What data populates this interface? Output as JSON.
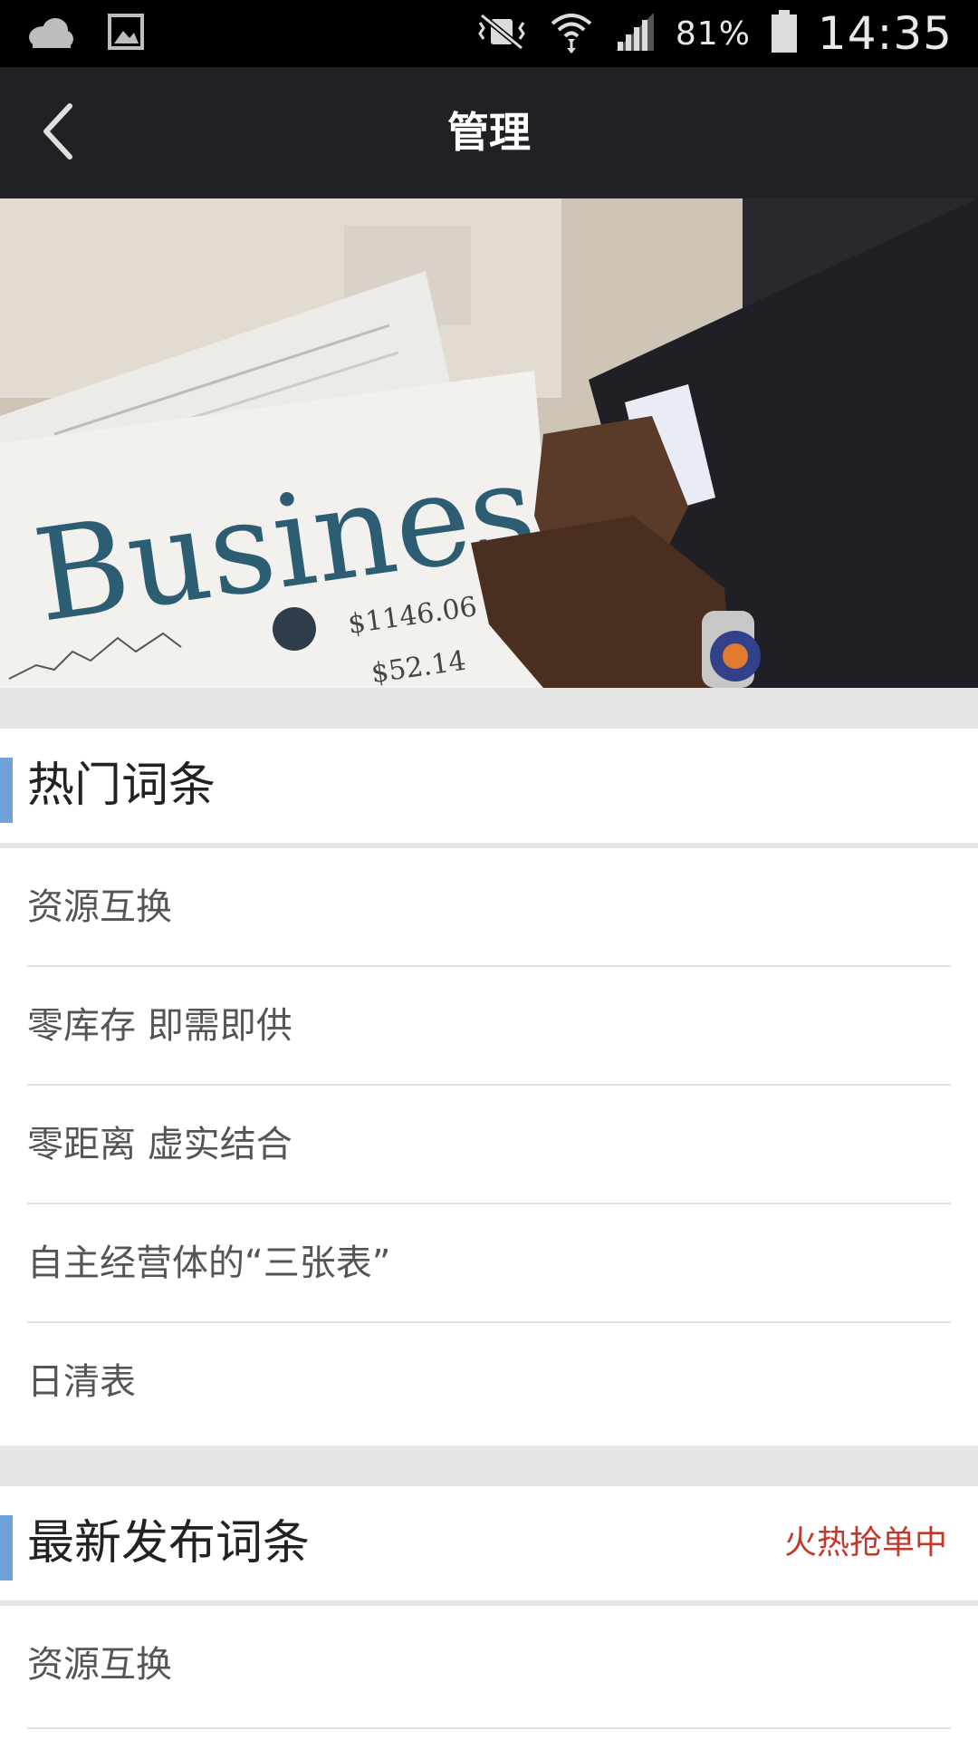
{
  "status_bar": {
    "battery_percent": "81%",
    "time": "14:35",
    "icons": [
      "cloud-icon",
      "image-icon",
      "vibrate-mute-icon",
      "wifi-icon",
      "signal-icon",
      "battery-icon"
    ]
  },
  "app_bar": {
    "title": "管理",
    "back_icon": "chevron-left-icon"
  },
  "banner": {
    "headline": "Business",
    "price_1": "$1146.06",
    "price_2": "$52.14"
  },
  "hot_section": {
    "title": "热门词条",
    "items": [
      {
        "label": "资源互换"
      },
      {
        "label": "零库存 即需即供"
      },
      {
        "label": "零距离 虚实结合"
      },
      {
        "label": "自主经营体的“三张表”"
      },
      {
        "label": "日清表"
      }
    ]
  },
  "latest_section": {
    "title": "最新发布词条",
    "extra": "火热抢单中",
    "items": [
      {
        "label": "资源互换"
      }
    ]
  },
  "colors": {
    "status_bar": "#000000",
    "app_bar": "#212125",
    "accent": "#6fa2d9",
    "hot_label": "#c0392b",
    "gap": "#e6e6e6"
  }
}
